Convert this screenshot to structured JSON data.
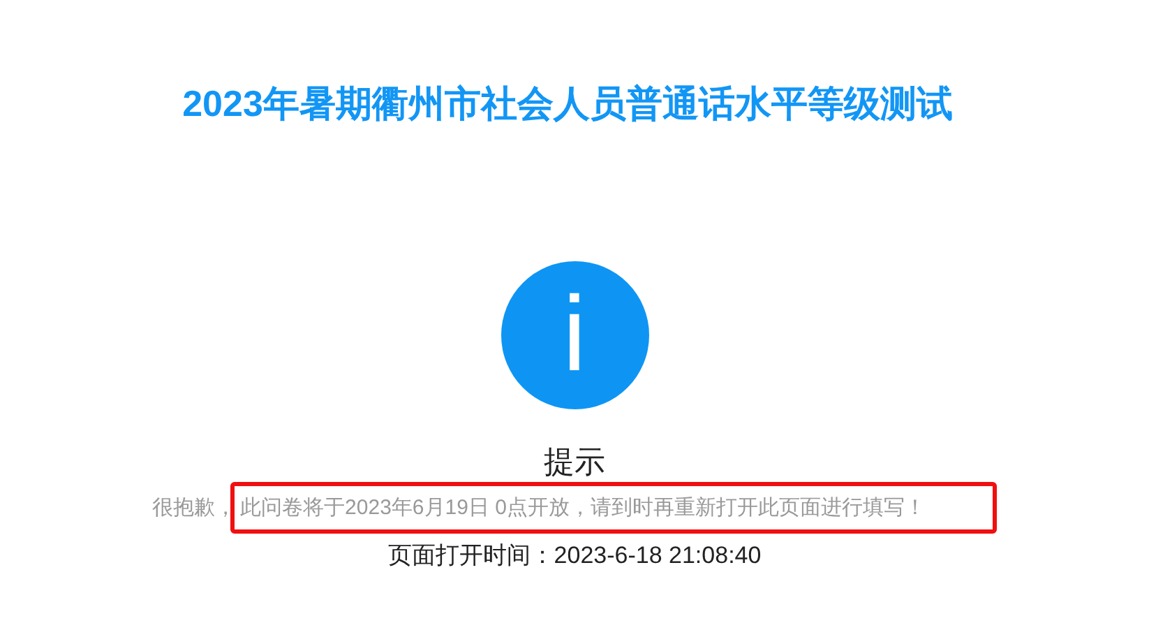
{
  "title": "2023年暑期衢州市社会人员普通话水平等级测试",
  "notice": {
    "icon": "i",
    "heading": "提示",
    "message_prefix": "很抱歉，",
    "message_highlighted": "此问卷将于2023年6月19日 0点开放，请到时再重新打开此页面进行填写！",
    "open_time_label": "页面打开时间：",
    "open_time": "2023-6-18 21:08:40"
  }
}
